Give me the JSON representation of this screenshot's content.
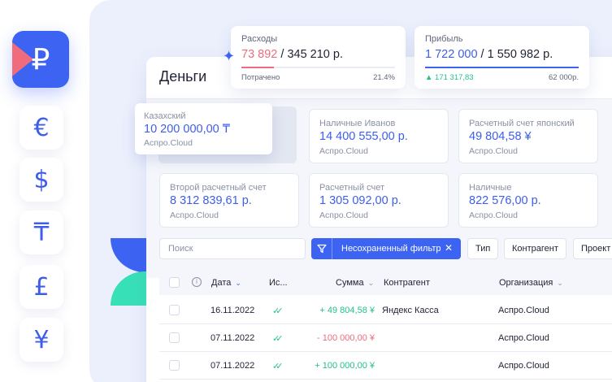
{
  "currencies": [
    {
      "symbol": "₽",
      "name": "ruble-icon",
      "active": true
    },
    {
      "symbol": "€",
      "name": "euro-icon"
    },
    {
      "symbol": "$",
      "name": "dollar-icon"
    },
    {
      "symbol": "₸",
      "name": "tenge-icon"
    },
    {
      "symbol": "£",
      "name": "pound-icon"
    },
    {
      "symbol": "¥",
      "name": "yen-icon"
    }
  ],
  "window": {
    "title": "Деньги"
  },
  "summary": {
    "expenses": {
      "label": "Расходы",
      "spent": "73 892",
      "separator": " / ",
      "total": "345 210 р.",
      "foot_left": "Потрачено",
      "foot_right": "21.4%",
      "progress": 0.214,
      "color": "#f06b7b"
    },
    "profit": {
      "label": "Прибыль",
      "current": "1 722 000",
      "separator": " / ",
      "total": "1 550 982 р.",
      "foot_left": "▲ 171 317,83",
      "foot_right": "62 000р.",
      "progress": 1.0,
      "color": "#3d63f2"
    }
  },
  "accounts": {
    "floating": {
      "name": "Казахский",
      "amount": "10 200 000,00 ₸",
      "source": "Аспро.Cloud"
    },
    "cards": [
      {
        "name": "Наличные Иванов",
        "amount": "14 400 555,00 р.",
        "source": "Аспро.Cloud"
      },
      {
        "name": "Расчетный счет японский",
        "amount": "49 804,58 ¥",
        "source": "Аспро.Cloud"
      },
      {
        "name": "Второй расчетный счет",
        "amount": "8 312 839,61 р.",
        "source": "Аспро.Cloud"
      },
      {
        "name": "Расчетный счет",
        "amount": "1 305 092,00 р.",
        "source": "Аспро.Cloud"
      },
      {
        "name": "Наличные",
        "amount": "822 576,00 р.",
        "source": "Аспро.Cloud"
      }
    ]
  },
  "filters": {
    "search_placeholder": "Поиск",
    "active_filter": "Несохраненный фильтр",
    "close": "✕",
    "chips": [
      "Тип",
      "Контрагент",
      "Проект"
    ]
  },
  "table": {
    "columns": {
      "date": "Дата",
      "status": "Ис...",
      "amount": "Сумма",
      "counterparty": "Контрагент",
      "organization": "Организация"
    },
    "rows": [
      {
        "date": "16.11.2022",
        "amount": "+ 49 804,58 ¥",
        "type": "pos",
        "counterparty": "Яндекс Касса",
        "organization": "Аспро.Cloud"
      },
      {
        "date": "07.11.2022",
        "amount": "- 100 000,00 ¥",
        "type": "neg",
        "counterparty": "",
        "organization": "Аспро.Cloud"
      },
      {
        "date": "07.11.2022",
        "amount": "+ 100 000,00 ¥",
        "type": "pos",
        "counterparty": "",
        "organization": "Аспро.Cloud"
      }
    ]
  },
  "colors": {
    "accent": "#3d63f2",
    "positive": "#22c08a",
    "negative": "#f06b7b",
    "mint": "#38e0b8"
  }
}
